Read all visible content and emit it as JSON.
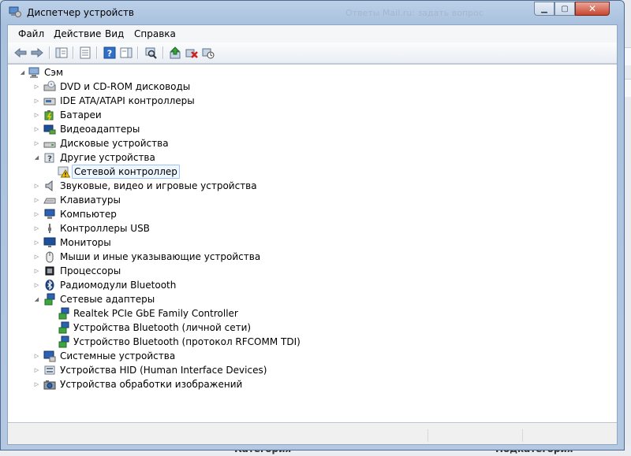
{
  "window": {
    "title": "Диспетчер устройств",
    "background_text": "Ответы Mail.ru: задать вопрос"
  },
  "menu": [
    {
      "label": "Файл"
    },
    {
      "label": "Действие"
    },
    {
      "label": "Вид"
    },
    {
      "label": "Справка"
    }
  ],
  "toolbar": {
    "icons": [
      "back-arrow",
      "forward-arrow",
      "show-hide-console-tree",
      "properties",
      "help",
      "show-action-pane",
      "scan-for-hardware-changes",
      "update-driver",
      "uninstall",
      "disable-device"
    ]
  },
  "tree": {
    "root": "Сэм",
    "categories": [
      {
        "label": "DVD и CD-ROM дисководы",
        "expanded": false
      },
      {
        "label": "IDE ATA/ATAPI контроллеры",
        "expanded": false
      },
      {
        "label": "Батареи",
        "expanded": false
      },
      {
        "label": "Видеоадаптеры",
        "expanded": false
      },
      {
        "label": "Дисковые устройства",
        "expanded": false
      },
      {
        "label": "Другие устройства",
        "expanded": true,
        "children": [
          "Сетевой контроллер"
        ]
      },
      {
        "label": "Звуковые, видео и игровые устройства",
        "expanded": false
      },
      {
        "label": "Клавиатуры",
        "expanded": false
      },
      {
        "label": "Компьютер",
        "expanded": false
      },
      {
        "label": "Контроллеры USB",
        "expanded": false
      },
      {
        "label": "Мониторы",
        "expanded": false
      },
      {
        "label": "Мыши и иные указывающие устройства",
        "expanded": false
      },
      {
        "label": "Процессоры",
        "expanded": false
      },
      {
        "label": "Радиомодули Bluetooth",
        "expanded": false
      },
      {
        "label": "Сетевые адаптеры",
        "expanded": true,
        "children": [
          "Realtek PCIe GbE Family Controller",
          "Устройства Bluetooth (личной сети)",
          "Устройство Bluetooth (протокол RFCOMM TDI)"
        ]
      },
      {
        "label": "Системные устройства",
        "expanded": false
      },
      {
        "label": "Устройства HID (Human Interface Devices)",
        "expanded": false
      },
      {
        "label": "Устройства обработки изображений",
        "expanded": false
      }
    ],
    "selected": "Сетевой контроллер"
  },
  "background_page": {
    "bottom_left": "Категория",
    "bottom_right": "Подкатегория"
  },
  "colors": {
    "selection_border": "#9dc6f4",
    "selection_fill": "#eef6ff",
    "warning": "#f2c200"
  }
}
